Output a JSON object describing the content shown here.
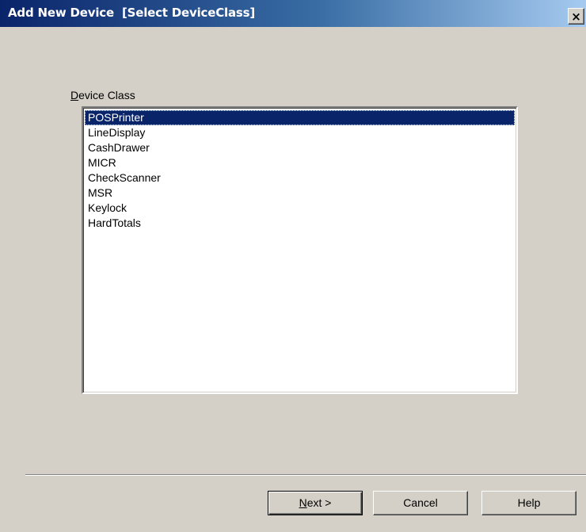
{
  "window": {
    "title": "Add New Device  [Select DeviceClass]",
    "close_glyph": "×"
  },
  "device_class": {
    "label_mnemonic": "D",
    "label_rest": "evice Class",
    "items": [
      {
        "label": "POSPrinter",
        "selected": true
      },
      {
        "label": "LineDisplay",
        "selected": false
      },
      {
        "label": "CashDrawer",
        "selected": false
      },
      {
        "label": "MICR",
        "selected": false
      },
      {
        "label": "CheckScanner",
        "selected": false
      },
      {
        "label": "MSR",
        "selected": false
      },
      {
        "label": "Keylock",
        "selected": false
      },
      {
        "label": "HardTotals",
        "selected": false
      }
    ]
  },
  "buttons": {
    "next_mnemonic": "N",
    "next_rest": "ext >",
    "cancel": "Cancel",
    "help": "Help"
  },
  "colors": {
    "dialog_bg": "#d4d0c8",
    "title_start": "#0a246a",
    "title_end": "#a6caf0",
    "selection": "#0a246a"
  }
}
